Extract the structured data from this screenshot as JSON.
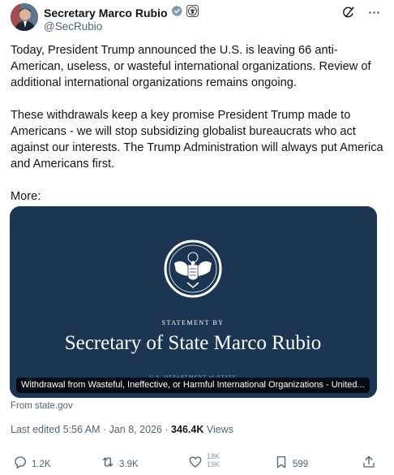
{
  "author": {
    "display_name": "Secretary Marco Rubio",
    "handle": "@SecRubio",
    "verified_badge": "gray-verified-badge-icon",
    "affiliate_badge": "us-seal-badge-icon"
  },
  "header_actions": [
    {
      "name": "grok-icon"
    },
    {
      "name": "more-icon"
    }
  ],
  "tweet": {
    "paragraphs": [
      "Today, President Trump announced the U.S. is leaving 66 anti-American, useless, or wasteful international organizations. Review of additional international organizations remains ongoing.",
      "These withdrawals keep a key promise President Trump made to Americans - we will stop subsidizing globalist bureaucrats who act against our interests. The Trump Administration will always put America and Americans first.",
      "More:"
    ]
  },
  "card": {
    "image": {
      "statement_by": "STATEMENT BY",
      "title": "Secretary of State Marco Rubio",
      "footer": "U.S. DEPARTMENT of STATE"
    },
    "caption": "Withdrawal from Wasteful, Ineffective, or Harmful International Organizations - United...",
    "from": "From state.gov"
  },
  "meta": {
    "edited": "Last edited 5:56 AM · Jan 8, 2026",
    "separator": " · ",
    "views_count": "346.4K",
    "views_label": " Views"
  },
  "actions": {
    "replies": "1.2K",
    "reposts": "3.9K",
    "likes_top": "18K",
    "likes_bottom": "19K",
    "bookmarks": "599"
  },
  "colors": {
    "text": "#0f1419",
    "secondary": "#536471",
    "card_bg": "#1c3553"
  }
}
